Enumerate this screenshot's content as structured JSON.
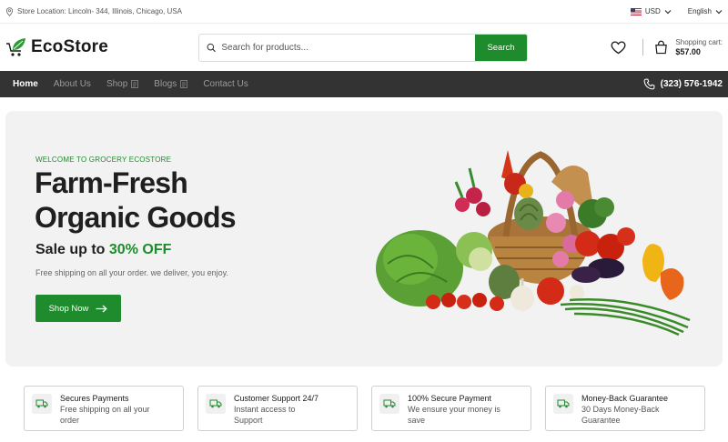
{
  "topbar": {
    "location": "Store Location: Lincoln- 344, Illinois, Chicago, USA",
    "currency": "USD",
    "language": "English"
  },
  "header": {
    "logo": "EcoStore",
    "search_placeholder": "Search for products...",
    "search_button": "Search",
    "cart_label": "Shopping cart:",
    "cart_total": "$57.00"
  },
  "nav": {
    "items": [
      "Home",
      "About Us",
      "Shop",
      "Blogs",
      "Contact Us"
    ],
    "phone": "(323) 576-1942"
  },
  "hero": {
    "welcome": "WELCOME TO GROCERY ECOSTORE",
    "title_line1": "Farm-Fresh",
    "title_line2": "Organic Goods",
    "sale_prefix": "Sale up to ",
    "sale_percent": "30% OFF",
    "shipping_text": "Free shipping on all your order. we deliver, you enjoy.",
    "cta": "Shop Now"
  },
  "features": [
    {
      "title": "Secures Payments",
      "desc_line1": "Free shipping on all your",
      "desc_line2": "order"
    },
    {
      "title": "Customer Support 24/7",
      "desc_line1": "Instant access to",
      "desc_line2": "Support"
    },
    {
      "title": "100% Secure Payment",
      "desc_line1": "We ensure your money is",
      "desc_line2": "save"
    },
    {
      "title": "Money-Back Guarantee",
      "desc_line1": "30 Days Money-Back",
      "desc_line2": "Guarantee"
    }
  ],
  "colors": {
    "brand_green": "#1e8b2c",
    "nav_bg": "#333333",
    "hero_bg": "#f2f2f2"
  }
}
